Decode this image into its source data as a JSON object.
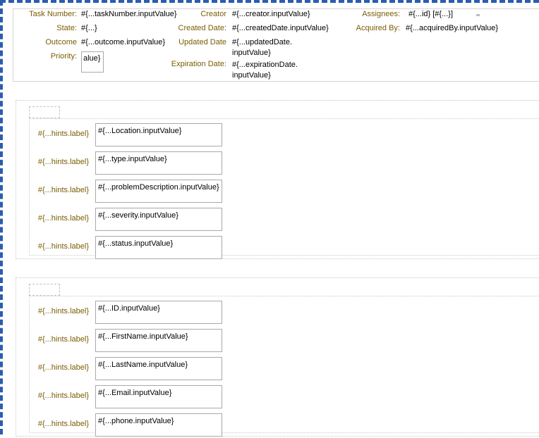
{
  "app": {
    "surface_name": "adf-task-details-design-surface"
  },
  "header": {
    "columns": [
      {
        "name": "task-identity-column",
        "rows": [
          {
            "label": "Task Number:",
            "value": "#{...taskNumber.inputValue}",
            "type": "text"
          },
          {
            "label": "State:",
            "value": "#{...}",
            "type": "text"
          },
          {
            "label": "Outcome",
            "value": "#{...outcome.inputValue}",
            "type": "text"
          },
          {
            "label": "Priority:",
            "value": "alue}",
            "type": "input"
          }
        ]
      },
      {
        "name": "task-dates-column",
        "rows": [
          {
            "label": "Creator",
            "value": "#{...creator.inputValue}",
            "type": "text"
          },
          {
            "label": "Created Date:",
            "value": "#{...createdDate.inputValue}",
            "type": "text"
          },
          {
            "label": "Updated Date",
            "value": "#{...updatedDate. inputValue}",
            "type": "text"
          },
          {
            "label": "Expiration Date:",
            "value": "#{...expirationDate. inputValue}",
            "type": "text"
          }
        ]
      },
      {
        "name": "task-assignment-column",
        "rows": [
          {
            "label": "Assignees:",
            "value": "#{...id} [#{...}]",
            "type": "text"
          },
          {
            "label": "Acquired By:",
            "value": "#{...acquiredBy.inputValue}",
            "type": "text"
          }
        ]
      }
    ]
  },
  "sections": [
    {
      "name": "problem-details-section",
      "fields": [
        {
          "label": "#{...hints.label}",
          "value": "#{...Location.inputValue}",
          "field": "location"
        },
        {
          "label": "#{...hints.label}",
          "value": "#{...type.inputValue}",
          "field": "type"
        },
        {
          "label": "#{...hints.label}",
          "value": "#{...problemDescription.inputValue}",
          "field": "problem-description"
        },
        {
          "label": "#{...hints.label}",
          "value": "#{...severity.inputValue}",
          "field": "severity"
        },
        {
          "label": "#{...hints.label}",
          "value": "#{...status.inputValue}",
          "field": "status"
        }
      ]
    },
    {
      "name": "contact-details-section",
      "fields": [
        {
          "label": "#{...hints.label}",
          "value": "#{...ID.inputValue}",
          "field": "id"
        },
        {
          "label": "#{...hints.label}",
          "value": "#{...FirstName.inputValue}",
          "field": "first-name"
        },
        {
          "label": "#{...hints.label}",
          "value": "#{...LastName.inputValue}",
          "field": "last-name"
        },
        {
          "label": "#{...hints.label}",
          "value": "#{...Email.inputValue}",
          "field": "email"
        },
        {
          "label": "#{...hints.label}",
          "value": "#{...phone.inputValue}",
          "field": "phone"
        }
      ]
    }
  ],
  "colors": {
    "label": "#7a5c00",
    "selection_border": "#2a5db0",
    "input_border": "#a9a9a9",
    "panel_border": "#c9c9c9"
  }
}
